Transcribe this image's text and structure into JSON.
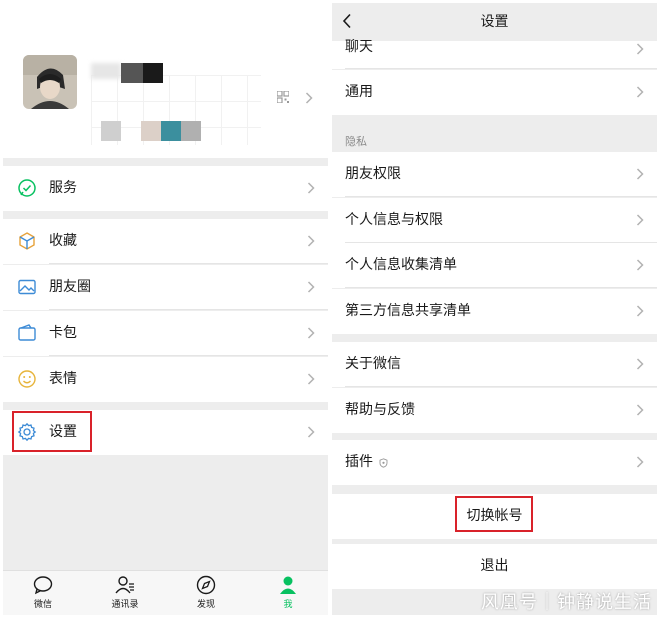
{
  "me_screen": {
    "menu": {
      "services": "服务",
      "favorites": "收藏",
      "moments": "朋友圈",
      "cards": "卡包",
      "stickers": "表情",
      "settings": "设置"
    },
    "tabbar": {
      "chats": "微信",
      "contacts": "通讯录",
      "discover": "发现",
      "me": "我"
    },
    "icons": {
      "services": "chat-check-icon",
      "favorites": "cube-icon",
      "moments": "image-icon",
      "cards": "wallet-icon",
      "stickers": "smile-icon",
      "settings": "gear-icon"
    }
  },
  "settings_screen": {
    "title": "设置",
    "rows_top": {
      "chat": "聊天",
      "general": "通用"
    },
    "privacy_section": "隐私",
    "privacy_rows": {
      "friend_permissions": "朋友权限",
      "personal_info": "个人信息与权限",
      "info_collection": "个人信息收集清单",
      "third_party": "第三方信息共享清单"
    },
    "about_rows": {
      "about": "关于微信",
      "help": "帮助与反馈"
    },
    "plugins": "插件",
    "switch_account": "切换帐号",
    "logout": "退出"
  },
  "watermark": "风凰号｜钟静说生活",
  "colors": {
    "accent_green": "#07c160",
    "highlight_red": "#d9222a",
    "background_gray": "#ededed"
  }
}
